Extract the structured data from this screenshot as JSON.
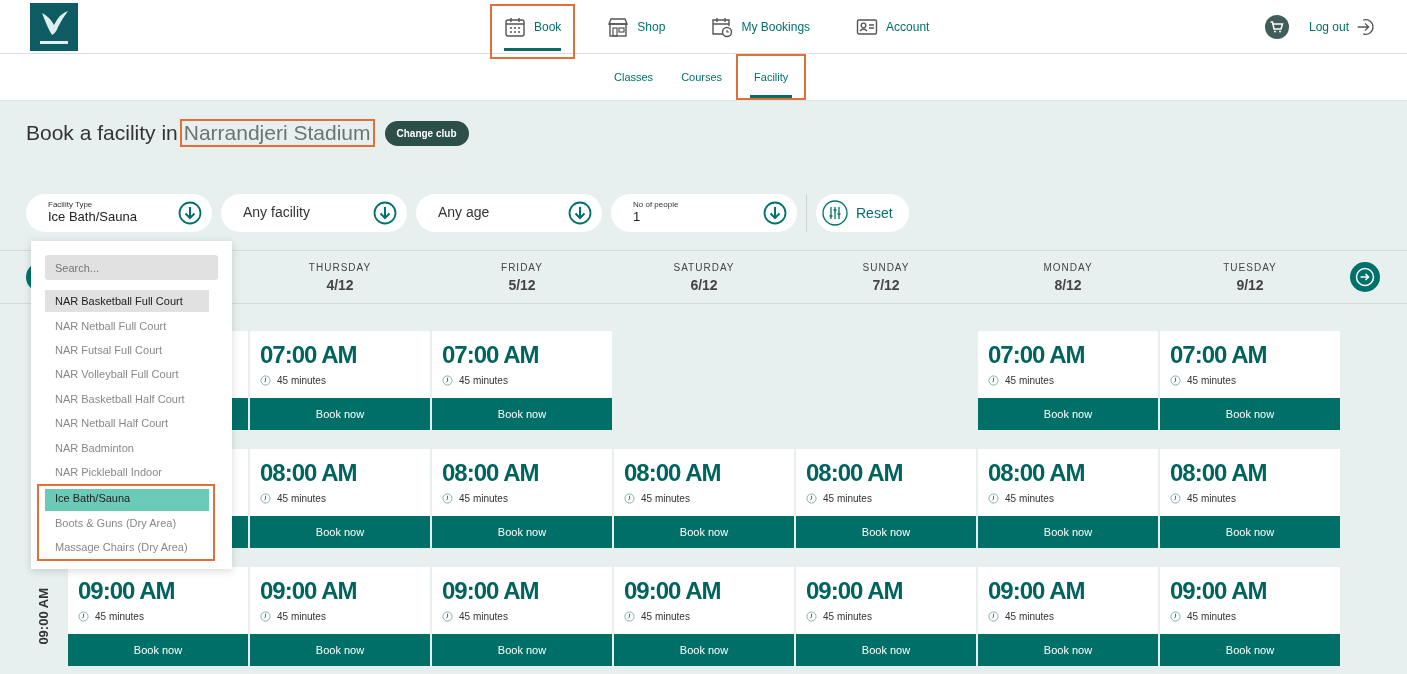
{
  "header": {
    "nav": [
      {
        "label": "Book",
        "selected": true,
        "annotated": true
      },
      {
        "label": "Shop",
        "selected": false,
        "annotated": false
      },
      {
        "label": "My Bookings",
        "selected": false,
        "annotated": false
      },
      {
        "label": "Account",
        "selected": false,
        "annotated": false
      }
    ],
    "logout": "Log out"
  },
  "subnav": [
    {
      "label": "Classes",
      "selected": false,
      "annotated": false
    },
    {
      "label": "Courses",
      "selected": false,
      "annotated": false
    },
    {
      "label": "Facility",
      "selected": true,
      "annotated": true
    }
  ],
  "title": {
    "prefix": "Book a facility in",
    "venue": "Narrandjeri Stadium",
    "venue_annotated": true,
    "button": "Change club"
  },
  "filters": [
    {
      "label": "Facility Type",
      "value": "Ice Bath/Sauna"
    },
    {
      "value": "Any facility"
    },
    {
      "value": "Any age"
    },
    {
      "label": "No of people",
      "value": "1"
    }
  ],
  "reset": "Reset",
  "dropdown": {
    "placeholder": "Search...",
    "options": [
      {
        "label": "NAR Basketball Full Court",
        "hovered": true,
        "selected": false,
        "annotated": false
      },
      {
        "label": "NAR Netball Full Court",
        "hovered": false,
        "selected": false,
        "annotated": false
      },
      {
        "label": "NAR Futsal Full Court",
        "hovered": false,
        "selected": false,
        "annotated": false
      },
      {
        "label": "NAR Volleyball Full Court",
        "hovered": false,
        "selected": false,
        "annotated": false
      },
      {
        "label": "NAR Basketball Half Court",
        "hovered": false,
        "selected": false,
        "annotated": false
      },
      {
        "label": "NAR Netball Half Court",
        "hovered": false,
        "selected": false,
        "annotated": false
      },
      {
        "label": "NAR Badminton",
        "hovered": false,
        "selected": false,
        "annotated": false
      },
      {
        "label": "NAR Pickleball Indoor",
        "hovered": false,
        "selected": false,
        "annotated": false
      },
      {
        "label": "Ice Bath/Sauna",
        "hovered": false,
        "selected": true,
        "annotated": true
      },
      {
        "label": "Boots & Guns (Dry Area)",
        "hovered": false,
        "selected": false,
        "annotated": true
      },
      {
        "label": "Massage Chairs (Dry Area)",
        "hovered": false,
        "selected": false,
        "annotated": true
      }
    ]
  },
  "days": [
    {
      "kind": "covered"
    },
    {
      "kind": "day",
      "name": "THURSDAY",
      "date": "4/12"
    },
    {
      "kind": "day",
      "name": "FRIDAY",
      "date": "5/12"
    },
    {
      "kind": "day",
      "name": "SATURDAY",
      "date": "6/12"
    },
    {
      "kind": "day",
      "name": "SUNDAY",
      "date": "7/12"
    },
    {
      "kind": "day",
      "name": "MONDAY",
      "date": "8/12"
    },
    {
      "kind": "day",
      "name": "TUESDAY",
      "date": "9/12"
    }
  ],
  "rows": [
    {
      "slots": [
        {
          "kind": "covered"
        },
        {
          "kind": "open",
          "time": "07:00 AM",
          "duration": "45 minutes",
          "button": "Book now"
        },
        {
          "kind": "open",
          "time": "07:00 AM",
          "duration": "45 minutes",
          "button": "Book now"
        },
        {
          "kind": "empty"
        },
        {
          "kind": "empty"
        },
        {
          "kind": "open",
          "time": "07:00 AM",
          "duration": "45 minutes",
          "button": "Book now"
        },
        {
          "kind": "open",
          "time": "07:00 AM",
          "duration": "45 minutes",
          "button": "Book now"
        }
      ]
    },
    {
      "slots": [
        {
          "kind": "covered"
        },
        {
          "kind": "open",
          "time": "08:00 AM",
          "duration": "45 minutes",
          "button": "Book now"
        },
        {
          "kind": "open",
          "time": "08:00 AM",
          "duration": "45 minutes",
          "button": "Book now"
        },
        {
          "kind": "open",
          "time": "08:00 AM",
          "duration": "45 minutes",
          "button": "Book now"
        },
        {
          "kind": "open",
          "time": "08:00 AM",
          "duration": "45 minutes",
          "button": "Book now"
        },
        {
          "kind": "open",
          "time": "08:00 AM",
          "duration": "45 minutes",
          "button": "Book now"
        },
        {
          "kind": "open",
          "time": "08:00 AM",
          "duration": "45 minutes",
          "button": "Book now"
        }
      ]
    },
    {
      "label": "09:00 AM",
      "slots": [
        {
          "kind": "open",
          "time": "09:00 AM",
          "duration": "45 minutes",
          "button": "Book now"
        },
        {
          "kind": "open",
          "time": "09:00 AM",
          "duration": "45 minutes",
          "button": "Book now"
        },
        {
          "kind": "open",
          "time": "09:00 AM",
          "duration": "45 minutes",
          "button": "Book now"
        },
        {
          "kind": "open",
          "time": "09:00 AM",
          "duration": "45 minutes",
          "button": "Book now"
        },
        {
          "kind": "open",
          "time": "09:00 AM",
          "duration": "45 minutes",
          "button": "Book now"
        },
        {
          "kind": "open",
          "time": "09:00 AM",
          "duration": "45 minutes",
          "button": "Book now"
        },
        {
          "kind": "open",
          "time": "09:00 AM",
          "duration": "45 minutes",
          "button": "Book now"
        }
      ]
    }
  ]
}
